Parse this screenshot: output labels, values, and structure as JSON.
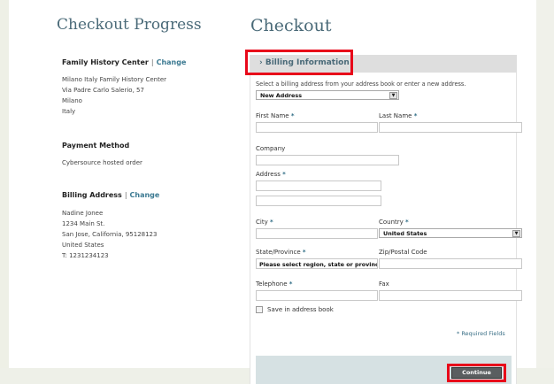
{
  "sidebar": {
    "title": "Checkout Progress",
    "sections": [
      {
        "title": "Family History Center",
        "sep": "|",
        "link": "Change",
        "lines": [
          "Milano Italy Family History Center",
          "Via Padre Carlo Salerio, 57",
          "Milano",
          "Italy"
        ]
      },
      {
        "title": "Payment Method",
        "lines": [
          "Cybersource hosted order"
        ]
      },
      {
        "title": "Billing Address",
        "sep": "|",
        "link": "Change",
        "lines": [
          "Nadine Jonee",
          "1234 Main St.",
          "San Jose, California, 95128123",
          "United States",
          "T: 1231234123"
        ]
      }
    ]
  },
  "main": {
    "title": "Checkout",
    "panel_header": "Billing Information",
    "header_bullet": "›",
    "hint": "Select a billing address from your address book or enter a new address.",
    "address_select": "New Address",
    "required_mark": "*",
    "fields": {
      "first_name": "First Name",
      "last_name": "Last Name",
      "company": "Company",
      "address": "Address",
      "city": "City",
      "country": "Country",
      "country_value": "United States",
      "state": "State/Province",
      "state_value": "Please select region, state or province",
      "zip": "Zip/Postal Code",
      "telephone": "Telephone",
      "fax": "Fax"
    },
    "save_label": "Save in address book",
    "required_note": "* Required Fields",
    "continue_label": "Continue",
    "select_arrow": "▼"
  },
  "colors": {
    "accent": "#4a6a78",
    "highlight": "#e8071a",
    "link": "#3c7a92"
  }
}
